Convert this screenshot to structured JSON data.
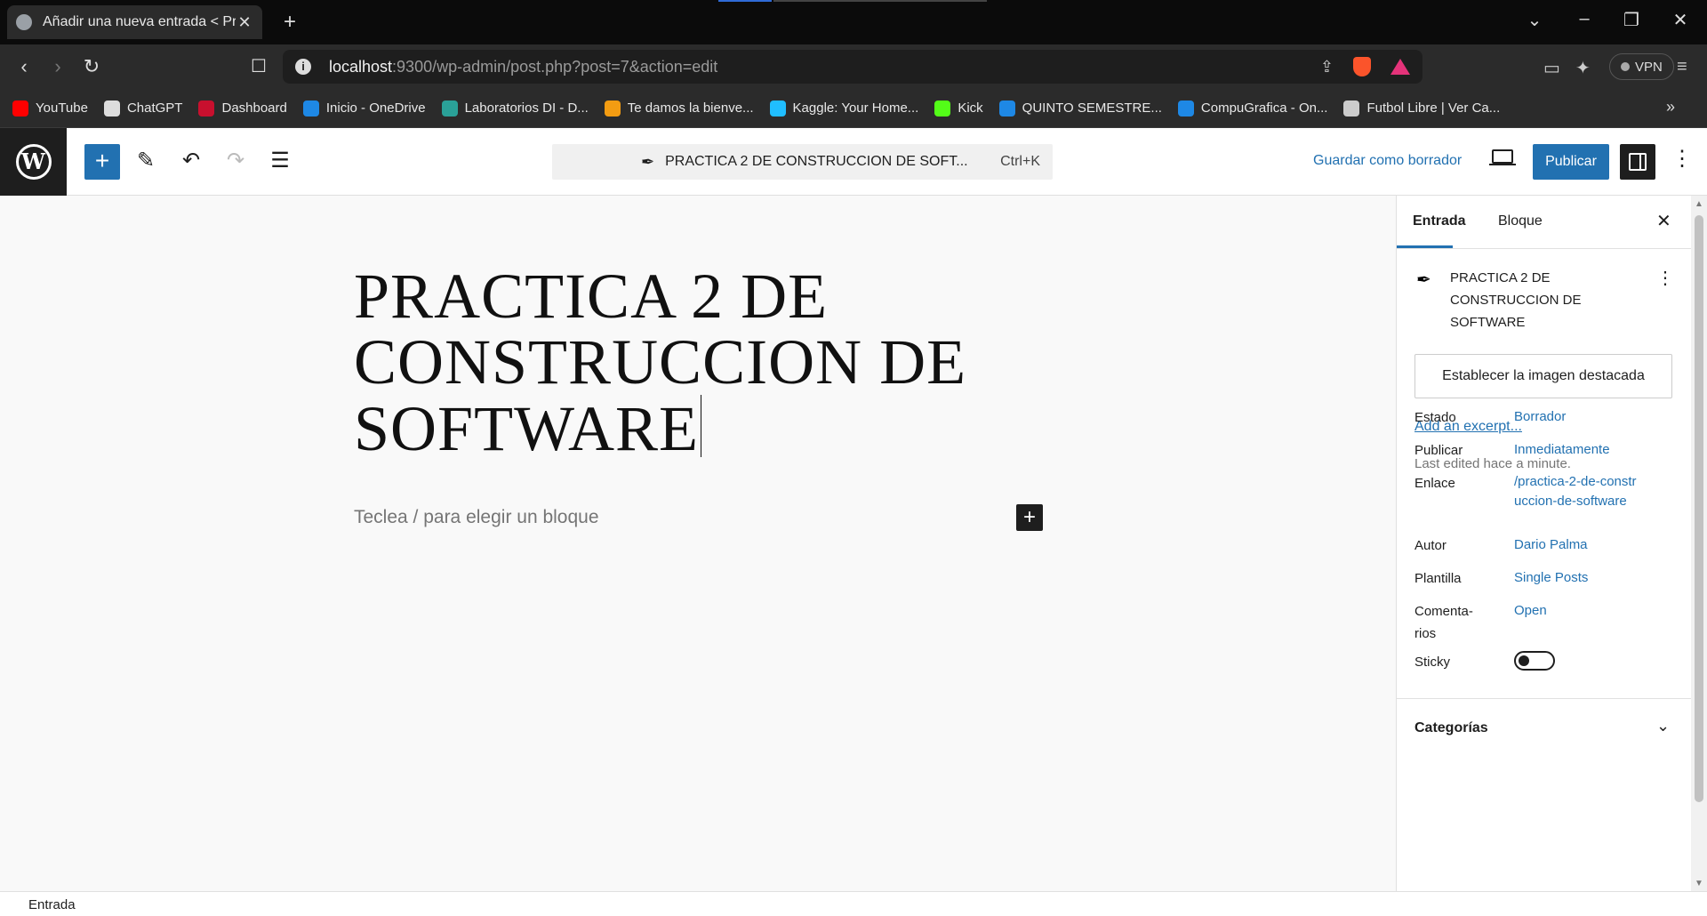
{
  "browser": {
    "tab_title": "Añadir una nueva entrada < Pr",
    "url_host": "localhost",
    "url_rest": ":9300/wp-admin/post.php?post=7&action=edit",
    "vpn_label": "VPN",
    "bookmarks": [
      {
        "label": "YouTube",
        "color": "#ff0000"
      },
      {
        "label": "ChatGPT",
        "color": "#dddddd"
      },
      {
        "label": "Dashboard",
        "color": "#c8102e"
      },
      {
        "label": "Inicio - OneDrive",
        "color": "#1e88e5"
      },
      {
        "label": "Laboratorios DI - D...",
        "color": "#2aa198"
      },
      {
        "label": "Te damos la bienve...",
        "color": "#f39c12"
      },
      {
        "label": "Kaggle: Your Home...",
        "color": "#20beff"
      },
      {
        "label": "Kick",
        "color": "#53fc18"
      },
      {
        "label": "QUINTO SEMESTRE...",
        "color": "#1e88e5"
      },
      {
        "label": "CompuGrafica - On...",
        "color": "#1e88e5"
      },
      {
        "label": "Futbol Libre | Ver Ca...",
        "color": "#cccccc"
      }
    ]
  },
  "editor": {
    "command_bar_title": "PRACTICA 2 DE CONSTRUCCION DE SOFT...",
    "command_bar_shortcut": "Ctrl+K",
    "save_draft_label": "Guardar como borrador",
    "publish_label": "Publicar",
    "post_title": "PRACTICA 2 DE CONSTRUCCION DE SOFTWARE",
    "block_placeholder": "Teclea / para elegir un bloque"
  },
  "sidebar": {
    "tab_post": "Entrada",
    "tab_block": "Bloque",
    "post_title": "PRACTICA 2 DE CONSTRUCCION DE SOFTWARE",
    "featured_image_label": "Establecer la imagen destacada",
    "excerpt_link": "Add an excerpt...",
    "last_edited": "Last edited hace a minute.",
    "rows": {
      "status": {
        "label": "Estado",
        "value": "Borrador"
      },
      "publish": {
        "label": "Publicar",
        "value": "Inmediatamente"
      },
      "link": {
        "label": "Enlace",
        "value": "/practica-2-de-construccion-de-software"
      },
      "author": {
        "label": "Autor",
        "value": "Dario Palma"
      },
      "template": {
        "label": "Plantilla",
        "value": "Single Posts"
      },
      "comments": {
        "label": "Comenta-rios",
        "value": "Open"
      },
      "sticky": {
        "label": "Sticky",
        "value": false
      }
    },
    "categories_label": "Categorías"
  },
  "footer": {
    "breadcrumb": "Entrada"
  },
  "colors": {
    "accent": "#2271b1",
    "dark": "#1e1e1e"
  }
}
